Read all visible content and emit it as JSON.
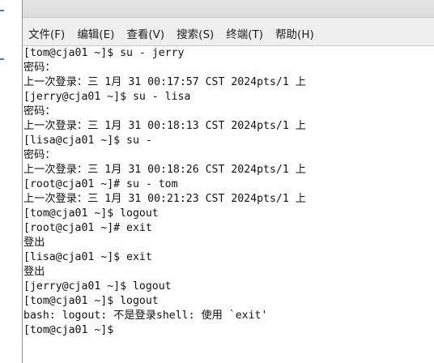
{
  "menubar": {
    "items": [
      {
        "label": "文件(F)"
      },
      {
        "label": "编辑(E)"
      },
      {
        "label": "查看(V)"
      },
      {
        "label": "搜索(S)"
      },
      {
        "label": "终端(T)"
      },
      {
        "label": "帮助(H)"
      }
    ]
  },
  "terminal": {
    "lines": [
      "[tom@cja01 ~]$ su - jerry",
      "密码：",
      "上一次登录：三 1月 31 00:17:57 CST 2024pts/1 上",
      "[jerry@cja01 ~]$ su - lisa",
      "密码：",
      "上一次登录：三 1月 31 00:18:13 CST 2024pts/1 上",
      "[lisa@cja01 ~]$ su -",
      "密码：",
      "上一次登录：三 1月 31 00:18:26 CST 2024pts/1 上",
      "[root@cja01 ~]# su - tom",
      "上一次登录：三 1月 31 00:21:23 CST 2024pts/1 上",
      "[tom@cja01 ~]$ logout",
      "[root@cja01 ~]# exit",
      "登出",
      "[lisa@cja01 ~]$ exit",
      "登出",
      "[jerry@cja01 ~]$ logout",
      "[tom@cja01 ~]$ logout",
      "bash: logout: 不是登录shell: 使用 `exit'",
      "[tom@cja01 ~]$ "
    ]
  }
}
